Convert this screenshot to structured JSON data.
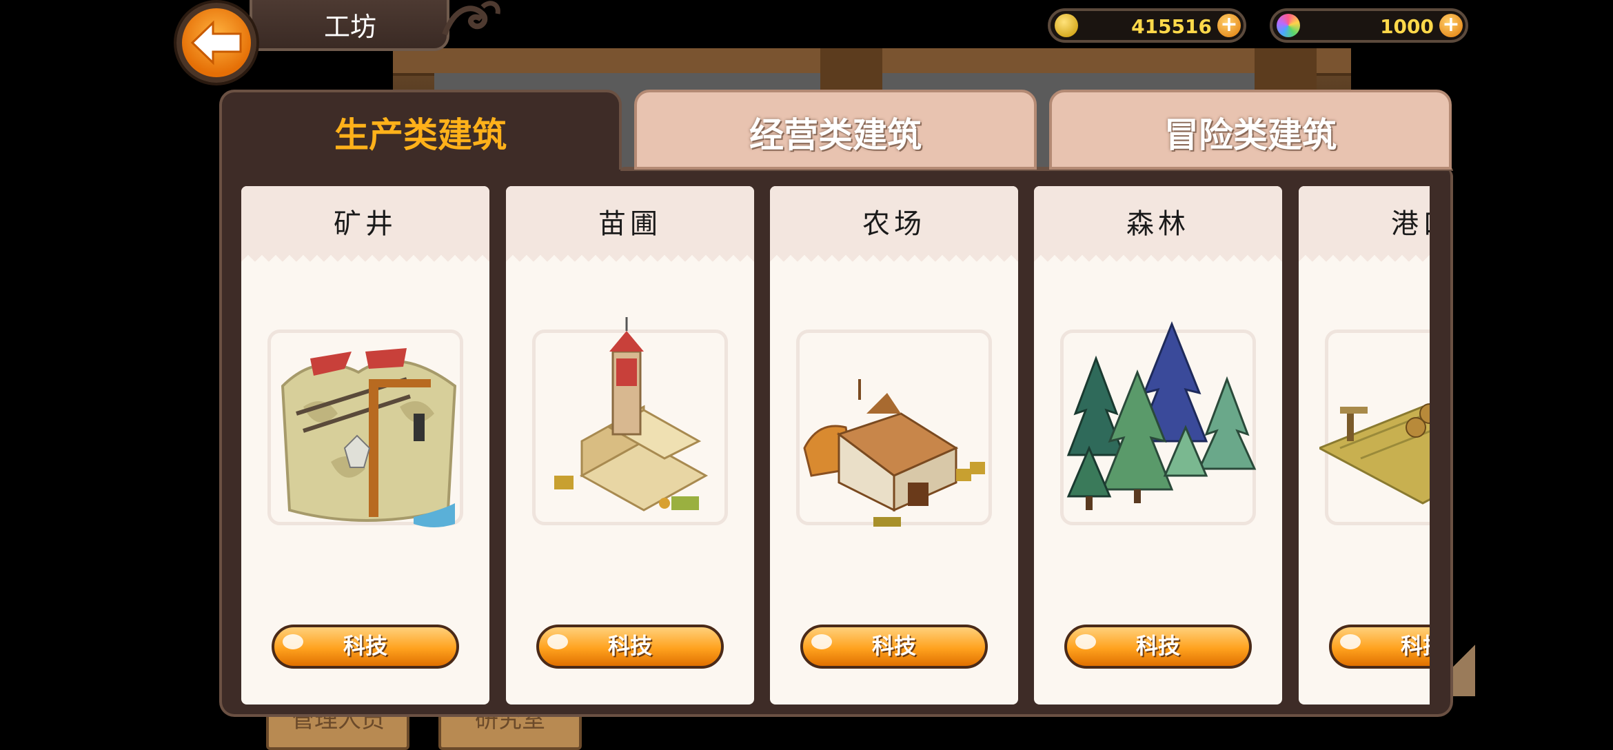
{
  "header": {
    "title": "工坊",
    "gold_value": "415516",
    "gem_value": "1000"
  },
  "background_signs": [
    "管理人员",
    "研究室"
  ],
  "tabs": [
    {
      "label": "生产类建筑",
      "active": true
    },
    {
      "label": "经营类建筑",
      "active": false
    },
    {
      "label": "冒险类建筑",
      "active": false
    }
  ],
  "buildings": [
    {
      "name": "矿井",
      "button": "科技",
      "icon": "mine-icon"
    },
    {
      "name": "苗圃",
      "button": "科技",
      "icon": "nursery-icon"
    },
    {
      "name": "农场",
      "button": "科技",
      "icon": "farm-icon"
    },
    {
      "name": "森林",
      "button": "科技",
      "icon": "forest-icon"
    },
    {
      "name": "港口",
      "button": "科技",
      "icon": "harbor-icon"
    }
  ],
  "colors": {
    "active_tab_text": "#ffb11a",
    "panel": "#3e2c27",
    "inactive_tab": "#e8c3b0",
    "button_orange": "#ffa21e",
    "currency_text": "#ffd94a"
  }
}
